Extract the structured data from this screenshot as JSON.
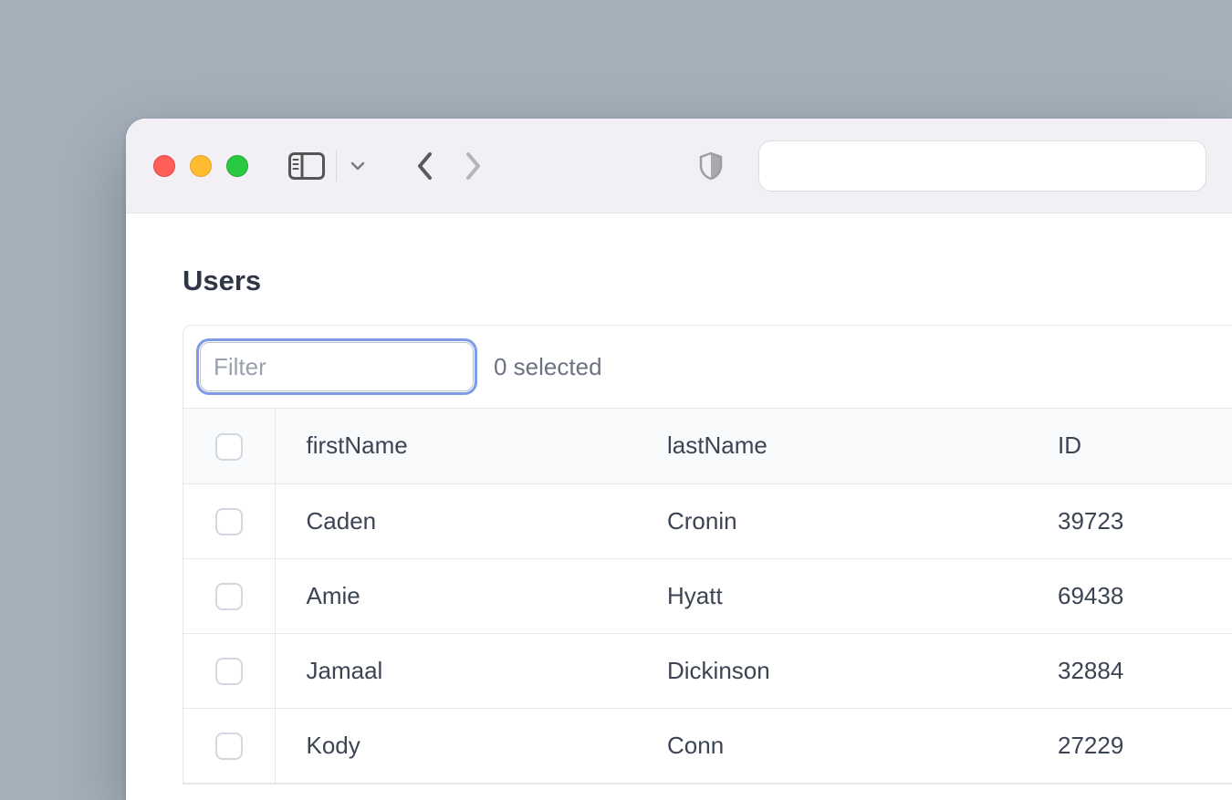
{
  "page": {
    "title": "Users"
  },
  "filter": {
    "placeholder": "Filter",
    "value": "",
    "selected_text": "0 selected"
  },
  "columns": {
    "firstName": "firstName",
    "lastName": "lastName",
    "id": "ID"
  },
  "rows": [
    {
      "firstName": "Caden",
      "lastName": "Cronin",
      "id": "39723"
    },
    {
      "firstName": "Amie",
      "lastName": "Hyatt",
      "id": "69438"
    },
    {
      "firstName": "Jamaal",
      "lastName": "Dickinson",
      "id": "32884"
    },
    {
      "firstName": "Kody",
      "lastName": "Conn",
      "id": "27229"
    }
  ]
}
